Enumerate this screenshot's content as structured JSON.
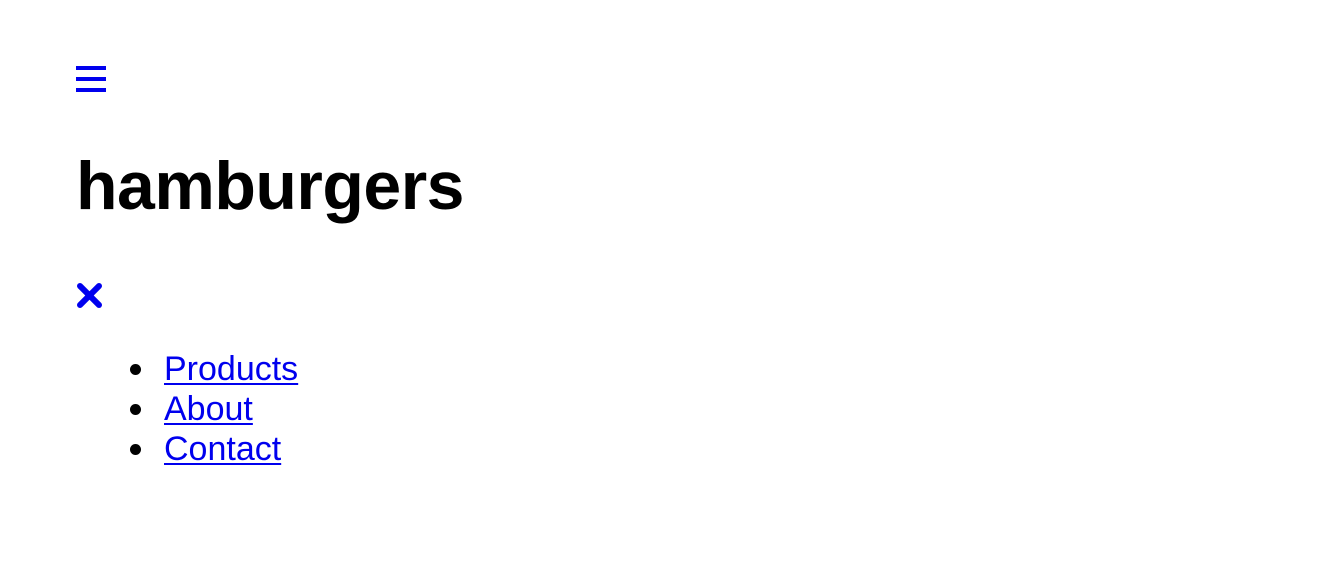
{
  "colors": {
    "link": "#0000ee",
    "text": "#000000",
    "background": "#ffffff"
  },
  "header": {
    "menu_icon": "hamburger-menu-icon",
    "title": "hamburgers"
  },
  "menu": {
    "close_icon": "close-icon",
    "items": [
      {
        "label": "Products"
      },
      {
        "label": "About"
      },
      {
        "label": "Contact"
      }
    ]
  }
}
